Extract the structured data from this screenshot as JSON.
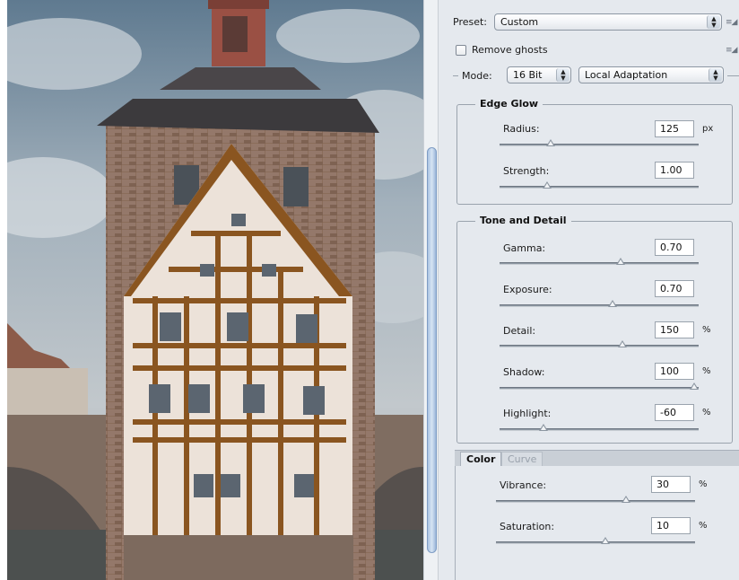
{
  "image": {
    "description_icon": "photo-preview"
  },
  "preset": {
    "label": "Preset:",
    "value": "Custom"
  },
  "remove_ghosts": {
    "label": "Remove ghosts",
    "checked": false
  },
  "mode": {
    "label": "Mode:",
    "bit_depth": "16 Bit",
    "method": "Local Adaptation"
  },
  "edge_glow": {
    "title": "Edge Glow",
    "radius": {
      "label": "Radius:",
      "value": "125",
      "unit": "px",
      "slider": 0.26
    },
    "strength": {
      "label": "Strength:",
      "value": "1.00",
      "unit": "",
      "slider": 0.24
    }
  },
  "tone_detail": {
    "title": "Tone and Detail",
    "gamma": {
      "label": "Gamma:",
      "value": "0.70",
      "unit": "",
      "slider": 0.61
    },
    "exposure": {
      "label": "Exposure:",
      "value": "0.70",
      "unit": "",
      "slider": 0.57
    },
    "detail": {
      "label": "Detail:",
      "value": "150",
      "unit": "%",
      "slider": 0.62
    },
    "shadow": {
      "label": "Shadow:",
      "value": "100",
      "unit": "%",
      "slider": 0.98
    },
    "highlight": {
      "label": "Highlight:",
      "value": "-60",
      "unit": "%",
      "slider": 0.22
    }
  },
  "tabs": {
    "color": "Color",
    "curve": "Curve"
  },
  "color": {
    "vibrance": {
      "label": "Vibrance:",
      "value": "30",
      "unit": "%",
      "slider": 0.65
    },
    "saturation": {
      "label": "Saturation:",
      "value": "10",
      "unit": "%",
      "slider": 0.55
    }
  },
  "colors": {
    "panel_bg": "#e5e9ee",
    "scroll_accent": "#a9c3e2"
  }
}
